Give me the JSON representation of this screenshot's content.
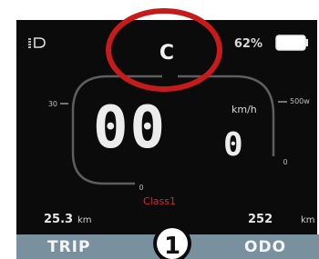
{
  "mode": {
    "letter": "C"
  },
  "battery": {
    "percent_text": "62%",
    "level": 0.9
  },
  "speedometer": {
    "speed_text": "00",
    "speed_decimal": "0",
    "unit": "km/h",
    "power_unit": "500w",
    "scale_left_label": "30",
    "scale_left_zero": "0",
    "scale_right_zero": "0"
  },
  "classification": {
    "label": "Class1"
  },
  "trip": {
    "value": "25.3",
    "unit": "km",
    "label": "TRIP"
  },
  "odo": {
    "value": "252",
    "unit": "km",
    "label": "ODO"
  },
  "assist_level": {
    "value": "1"
  },
  "colors": {
    "screen_bg": "#0b0b0c",
    "bar_bg": "#79909f",
    "highlight_circle": "#c61b1b",
    "class_label": "#d42a2a",
    "digits": "#ececec"
  },
  "icons": {
    "headlight": "headlight-icon",
    "battery": "battery-icon",
    "highlight": "highlight-circle"
  }
}
